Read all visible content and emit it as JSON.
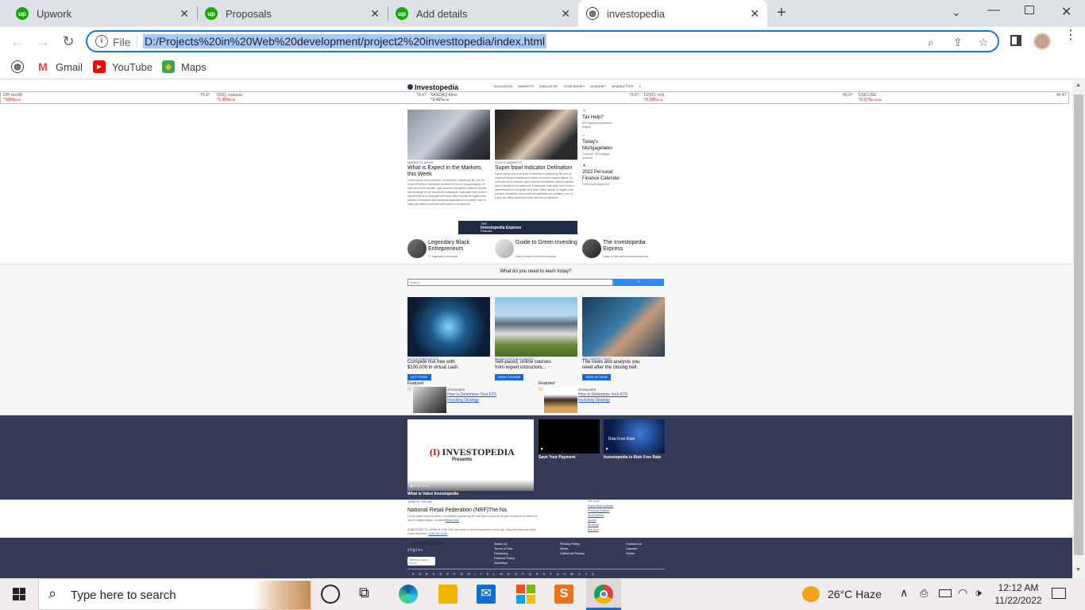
{
  "browser": {
    "tabs": [
      {
        "label": "Upwork",
        "icon": "upwork-icon",
        "active": false
      },
      {
        "label": "Proposals",
        "icon": "upwork-icon",
        "active": false
      },
      {
        "label": "Add details",
        "icon": "upwork-icon",
        "active": false
      },
      {
        "label": "investopedia",
        "icon": "globe-icon",
        "active": true
      }
    ],
    "address": {
      "scheme_label": "File",
      "url": "D:/Projects%20in%20Web%20development/project2%20investtopedia/index.html"
    },
    "bookmarks": [
      {
        "label": "Gmail",
        "icon": "gmail-icon"
      },
      {
        "label": "YouTube",
        "icon": "youtube-icon"
      },
      {
        "label": "Maps",
        "icon": "maps-icon"
      }
    ]
  },
  "site": {
    "logo": "Investopedia",
    "nav": [
      "EDUCATION",
      "MARKETS",
      "SIMULATOR",
      "YOUR MONEY",
      "ACADEMY",
      "NEWSLETTER"
    ],
    "ticker": [
      {
        "name": "DPI world0",
        "value": "^189%",
        "small": "5.05"
      },
      {
        "name": "DOQ, nasqual",
        "value": "^1.45%",
        "small": "0.05"
      },
      {
        "name": "NASDAQ Ahoo",
        "value": "^3.49%",
        "small": "0.08"
      },
      {
        "name": "DZ001 rent",
        "value": "^0.09%",
        "small": "3.08"
      },
      {
        "name": "USD-USE",
        "value": "^0.07%",
        "small": "2.02045"
      }
    ],
    "ticker_prices": [
      "79.47",
      "79.47",
      "79.47",
      "49.47",
      "49.47"
    ],
    "hero": [
      {
        "category": "MARKETS NEWS",
        "title": "What is Expect in the Markets this Week"
      },
      {
        "category": "STOCK MARKETS",
        "title": "Super bowl Indicator Defination"
      }
    ],
    "lorem": "Lorem ipsum dolor sit amet, consectetur adipiscing elit, sed do eiusmod tempor incididunt ut labore et dolore magna aliqua. Ut enim ad minim veniam, quis nostrud exercitation ullamco laboris nisi ut aliquip ex ea commodo consequat. Duis aute irure dolor in reprehenderit in voluptate velit esse cillum dolore eu fugiat nulla pariatur. Excepteur sint occaecat cupidatat non proident, sunt in culpa qui officia deserunt mollit anim id est laborum.",
    "side_links": [
      {
        "title": "Tax Help?",
        "sub": "IRS taxpayer assistance begins"
      },
      {
        "title": "Today's Mortgagelates",
        "sub": "Compare 78 mortgage products"
      },
      {
        "title": "2022 Personal Finance Calendar",
        "sub": "Time to get organized"
      }
    ],
    "banner": {
      "line1": "THE",
      "line2": "Investopedia Express",
      "line3": "Podcast"
    },
    "promos": [
      {
        "title": "Legendary Black Entrepreneurs",
        "sub": "77 legendary luminaries"
      },
      {
        "title": "Guide to Green Investing",
        "sub": "How to invest in the environment"
      },
      {
        "title": "The Investopedia Express",
        "sub": "Listen to this week's podcast episode"
      }
    ],
    "learn": {
      "heading": "What do you need to learn today?",
      "placeholder": "Search"
    },
    "features": [
      {
        "category": "STOCK SIMULATOR",
        "title": "Compete risk free with $100,000 in virtual cash.",
        "button": "GET START"
      },
      {
        "category": "INVESTOPEDIA ACADEMY",
        "title": "Self-paced, online courses from expert instructors...",
        "button": "VIEW COURSE"
      },
      {
        "category": "THE MARKET SUM",
        "title": "The news and analysis you need after the closing bell.",
        "button": "SIGN UP NOW"
      }
    ],
    "featured": [
      {
        "label": "Featured",
        "num": "01",
        "sponsored": "SPONSORED",
        "link": "How to Determine Your ETF Investing Strategy"
      },
      {
        "label": "Featured",
        "num": "01",
        "sponsored": "SPONSORED",
        "link": "How to Determine Your ETF Investing Strategy"
      }
    ],
    "videos": [
      {
        "title": "What is Value Investopedia",
        "poster_line1": "INVESTOPEDIA",
        "poster_line2": "Presents",
        "time": "0:00 / 1:01"
      },
      {
        "title": "Save Your Payment"
      },
      {
        "title": "Investopedia is Risk Free Rate",
        "poster": "Risk Free Rate"
      }
    ],
    "term": {
      "label": "TERM OF THE DAY",
      "title": "National Retail Federation (NRF)The Na",
      "body": "Lorem ipsum dolor sit amet, consectetur adipiscing elit, sed diam nonummy tempor incididunt ut labore et dolore magna aliqua. Ut labore",
      "read_more": "Read more",
      "subscribe": "SUBSCRIBE TO TERM OF THE DAY and learn a new financial term every day. Stay informed and make smart decisions.",
      "signup": "SIGN UP NOW",
      "trending_label": "See more",
      "trending": [
        "Super Bowl Indicator",
        "Personal Finance",
        "Stock Market",
        "Stocks",
        "Dividend",
        "Bull Run"
      ]
    },
    "footer": {
      "logo": "Investopedia",
      "col1": [
        "About Us",
        "Terms of Use",
        "Dictionary",
        "Editorial Policy",
        "Advertise"
      ],
      "col2": [
        "Privacy Policy",
        "News",
        "California Privacy"
      ],
      "col3": [
        "Contact Us",
        "Careers",
        "Ombe"
      ],
      "trustee": "TRUSTe Certified Privacy",
      "alphabet": [
        "#",
        "A",
        "B",
        "C",
        "D",
        "E",
        "F",
        "G",
        "H",
        "I",
        "J",
        "K",
        "L",
        "M",
        "N",
        "O",
        "P",
        "Q",
        "R",
        "S",
        "T",
        "U",
        "V",
        "W",
        "X",
        "Y",
        "Z"
      ]
    }
  },
  "taskbar": {
    "search_placeholder": "Type here to search",
    "weather": "26°C  Haze",
    "time": "12:12 AM",
    "date": "11/22/2022"
  },
  "colors": {
    "upwork": "#14a800",
    "navy": "#353a59",
    "accent": "#1a73e8"
  }
}
